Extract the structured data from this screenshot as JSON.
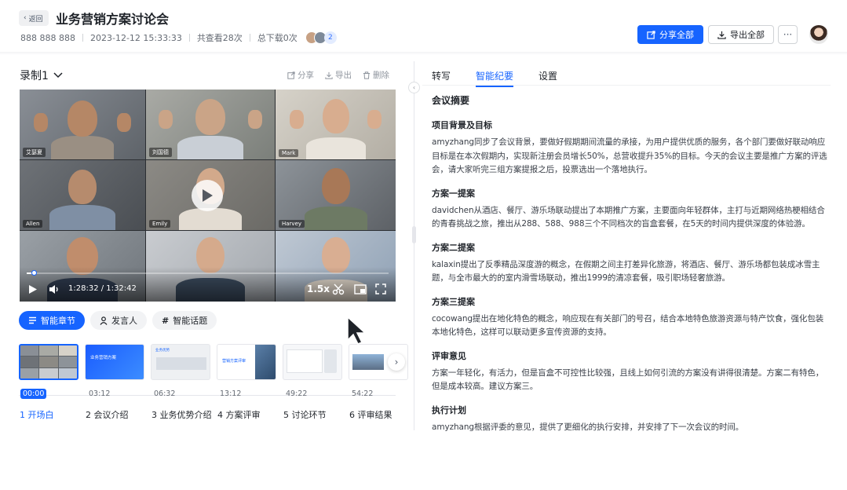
{
  "header": {
    "back_label": "返回",
    "title": "业务营销方案讨论会",
    "meeting_id": "888 888 888",
    "datetime": "2023-12-12 15:33:33",
    "views": "共查看28次",
    "downloads": "总下载0次",
    "participant_extra": "2",
    "share_all_label": "分享全部",
    "export_all_label": "导出全部",
    "more_label": "···"
  },
  "recording": {
    "title": "录制1",
    "actions": {
      "share": "分享",
      "export": "导出",
      "delete": "删除"
    },
    "player": {
      "current_time": "1:28:32",
      "duration": "1:32:42",
      "time_display": "1:28:32 / 1:32:42",
      "speed": "1.5x",
      "progress": 0.02
    },
    "participants": [
      "艾瑟夏",
      "刘国德",
      "Mark",
      "Allen",
      "Emily",
      "Harvey"
    ]
  },
  "chips": {
    "chapters": "智能章节",
    "speakers": "发言人",
    "topics": "智能话题"
  },
  "chapters": [
    {
      "time": "00:00",
      "label": "1 开场白",
      "active": true
    },
    {
      "time": "03:12",
      "label": "2 会议介绍",
      "active": false
    },
    {
      "time": "06:32",
      "label": "3 业务优势介绍",
      "active": false
    },
    {
      "time": "13:12",
      "label": "4 方案评审",
      "active": false
    },
    {
      "time": "49:22",
      "label": "5 讨论环节",
      "active": false
    },
    {
      "time": "54:22",
      "label": "6 评审结果",
      "active": false
    }
  ],
  "thumb_texts": {
    "t2": "业务营销方案",
    "t3": "业务优势",
    "t4": "营销方案评审"
  },
  "tabs": {
    "transcript": "转写",
    "minutes": "智能纪要",
    "settings": "设置"
  },
  "summary": {
    "title": "会议摘要",
    "sections": [
      {
        "title": "项目背景及目标",
        "body": "amyzhang同步了会议背景，要做好假期期间流量的承接，为用户提供优质的服务，各个部门要做好联动响应目标是在本次假期内，实现新注册会员增长50%，总营收提升35%的目标。今天的会议主要是推广方案的评选会，请大家听完三组方案提报之后，投票选出一个落地执行。"
      },
      {
        "title": "方案一提案",
        "body": "davidchen从酒店、餐厅、游乐场联动提出了本期推广方案，主要面向年轻群体，主打与近期网络热梗相结合的青春挑战之旅，推出从288、588、988三个不同档次的盲盒套餐，在5天的时间内提供深度的体验游。"
      },
      {
        "title": "方案二提案",
        "body": "kalaxin提出了反季精品深度游的概念，在假期之间主打差异化旅游，将酒店、餐厅、游乐场都包装成冰雪主题，与全市最大的的室内滑雪场联动，推出1999的清凉套餐，吸引职场轻奢旅游。"
      },
      {
        "title": "方案三提案",
        "body": "cocowang提出在地化特色的概念，响应现在有关部门的号召，结合本地特色旅游资源与特产饮食，强化包装本地化特色，这样可以联动更多宣传资源的支持。"
      },
      {
        "title": "评审意见",
        "body": "方案一年轻化，有活力，但是盲盒不可控性比较强，且线上如何引流的方案没有讲得很清楚。方案二有特色，但是成本较高。建议方案三。"
      },
      {
        "title": "执行计划",
        "body": "amyzhang根据评委的意见，提供了更细化的执行安排，并安排了下一次会议的时间。"
      }
    ]
  },
  "colors": {
    "accent": "#1664ff",
    "text": "#1f2329",
    "muted": "#646a73"
  }
}
